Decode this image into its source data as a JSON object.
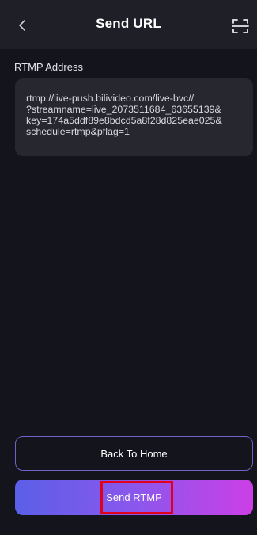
{
  "header": {
    "title": "Send URL",
    "back_icon": "chevron-left-icon",
    "scan_icon": "scan-icon"
  },
  "form": {
    "rtmp_label": "RTMP Address",
    "rtmp_value": "rtmp://live-push.bilivideo.com/live-bvc//\n?streamname=live_2073511684_63655139&\nkey=174a5ddf89e8bdcd5a8f28d825eae025&\nschedule=rtmp&pflag=1"
  },
  "actions": {
    "back_home_label": "Back To Home",
    "send_rtmp_label": "Send RTMP"
  },
  "colors": {
    "background": "#14141c",
    "header": "#1f1f28",
    "box": "#272730",
    "border_accent": "#6e63c6",
    "gradient_start": "#5b5fe8",
    "gradient_end": "#cc3fe6",
    "highlight": "#e0001a"
  }
}
